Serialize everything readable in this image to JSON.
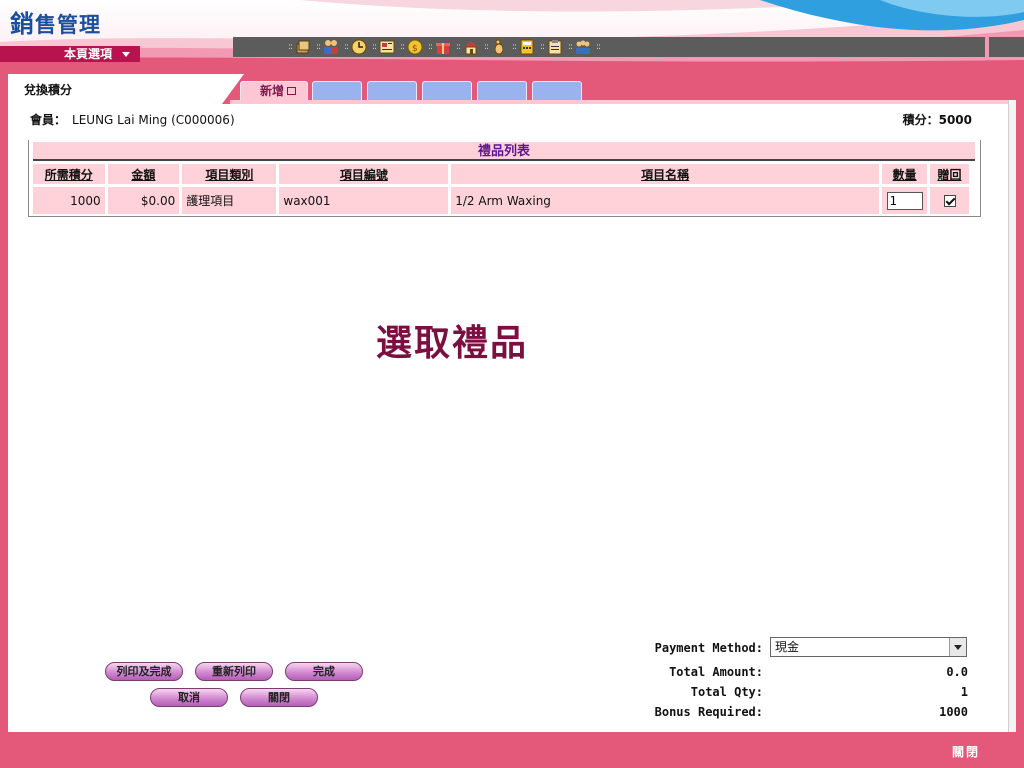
{
  "header": {
    "app_title_first": "銷",
    "app_title_rest": "售管理",
    "page_menu_label": "本頁選項"
  },
  "toolbar": {
    "icons": [
      "stack-icon",
      "people-icon",
      "clock-icon",
      "news-icon",
      "coin-icon",
      "gift-icon",
      "home-icon",
      "foot-icon",
      "calculator-icon",
      "clipboard-icon",
      "group-icon"
    ],
    "separator": "::"
  },
  "colors": {
    "brand_pink": "#e4587a",
    "toolbar_gray": "#5c5c5c",
    "title_blue": "#1b4f9c",
    "heading_maroon": "#7b1040"
  },
  "page": {
    "title": "兌換積分"
  },
  "tabs": [
    {
      "label": "新增"
    },
    {
      "label": ""
    },
    {
      "label": ""
    },
    {
      "label": ""
    },
    {
      "label": ""
    },
    {
      "label": ""
    }
  ],
  "member": {
    "label": "會員：",
    "value": "LEUNG Lai Ming (C000006)"
  },
  "points": {
    "label": "積分：",
    "value": "5000"
  },
  "gift_table": {
    "title": "禮品列表",
    "columns": [
      "所需積分",
      "金額",
      "項目類別",
      "項目編號",
      "項目名稱",
      "數量",
      "贈回"
    ],
    "rows": [
      {
        "points": "1000",
        "amount": "$0.00",
        "category": "護理項目",
        "code": "wax001",
        "name": "1/2 Arm Waxing",
        "qty": "1",
        "gift_return": true
      }
    ]
  },
  "heading": "選取禮品",
  "payment": {
    "method_label": "Payment Method:",
    "method_value": "現金",
    "total_amount_label": "Total Amount:",
    "total_amount_value": "0.0",
    "total_qty_label": "Total Qty:",
    "total_qty_value": "1",
    "bonus_label": "Bonus Required:",
    "bonus_value": "1000"
  },
  "buttons": {
    "print_complete": "列印及完成",
    "reprint": "重新列印",
    "complete": "完成",
    "cancel": "取消",
    "close": "關閉"
  },
  "footer": {
    "close_label": "關閉"
  }
}
